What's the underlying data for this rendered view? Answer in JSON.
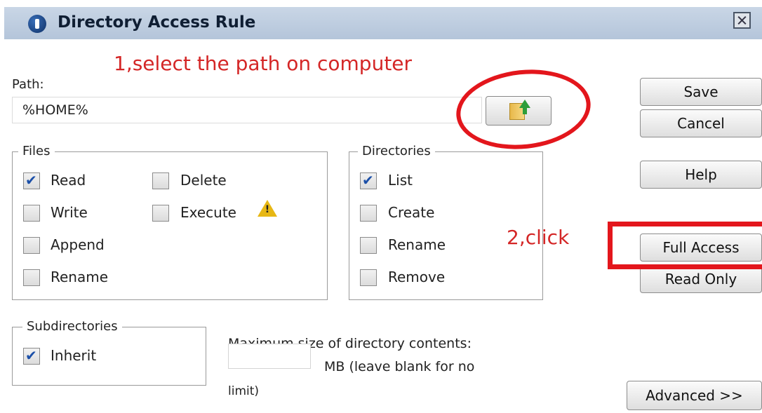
{
  "window": {
    "title": "Directory Access Rule"
  },
  "annotations": {
    "step1": "1,select the path on computer",
    "step2": "2,click"
  },
  "path": {
    "label": "Path:",
    "value": "%HOME%"
  },
  "files": {
    "legend": "Files",
    "items": [
      {
        "label": "Read",
        "checked": true
      },
      {
        "label": "Delete",
        "checked": false
      },
      {
        "label": "Write",
        "checked": false
      },
      {
        "label": "Execute",
        "checked": false
      },
      {
        "label": "Append",
        "checked": false
      },
      {
        "label": "Rename",
        "checked": false
      }
    ]
  },
  "directories": {
    "legend": "Directories",
    "items": [
      {
        "label": "List",
        "checked": true
      },
      {
        "label": "Create",
        "checked": false
      },
      {
        "label": "Rename",
        "checked": false
      },
      {
        "label": "Remove",
        "checked": false
      }
    ]
  },
  "subdirectories": {
    "legend": "Subdirectories",
    "inherit": {
      "label": "Inherit",
      "checked": true
    }
  },
  "max_size": {
    "label": "Maximum size of directory contents:",
    "unit_note": "MB (leave blank for no",
    "unit_note_cont": "limit)",
    "value": ""
  },
  "buttons": {
    "save": "Save",
    "cancel": "Cancel",
    "help": "Help",
    "full_access": "Full Access",
    "read_only": "Read Only",
    "advanced": "Advanced >>"
  },
  "icons": {
    "app": "app-icon",
    "close": "close-icon",
    "browse": "folder-up-icon",
    "warning": "warning-icon"
  },
  "colors": {
    "annotation": "#e3161c",
    "title_bar": "#c9d6e6",
    "checkmark": "#1b4fa8"
  }
}
